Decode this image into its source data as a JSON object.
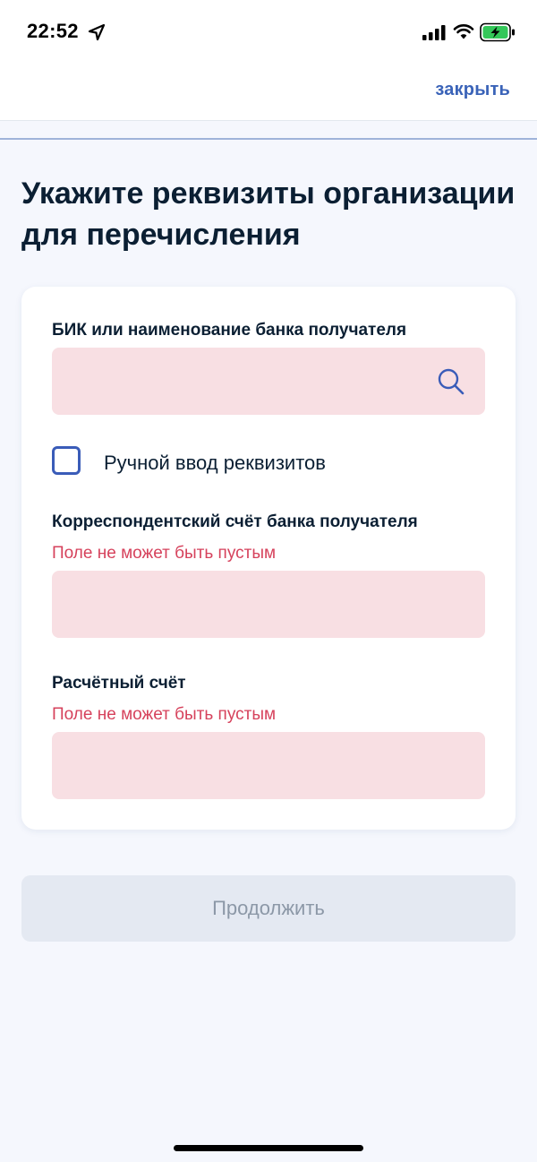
{
  "status_bar": {
    "time": "22:52",
    "icons": [
      "location-arrow-icon",
      "cellular-signal-icon",
      "wifi-icon",
      "battery-charging-icon"
    ]
  },
  "nav": {
    "close_label": "закрыть"
  },
  "page": {
    "title": "Укажите реквизиты организации для перечисления"
  },
  "form": {
    "bank_field": {
      "label": "БИК или наименование банка получателя",
      "value": "",
      "icon": "search-icon"
    },
    "manual_entry": {
      "label": "Ручной ввод реквизитов",
      "checked": false
    },
    "correspondent_account": {
      "label": "Корреспондентский счёт банка получателя",
      "error": "Поле не может быть пустым",
      "value": ""
    },
    "settlement_account": {
      "label": "Расчётный счёт",
      "error": "Поле не может быть пустым",
      "value": ""
    }
  },
  "actions": {
    "continue_label": "Продолжить"
  },
  "colors": {
    "accent": "#3a63b8",
    "error": "#d6425c",
    "error_field_bg": "#f8dfe3",
    "page_bg": "#f5f7fd",
    "disabled_button_bg": "#e4e9f2",
    "disabled_button_text": "#8c98a7"
  }
}
